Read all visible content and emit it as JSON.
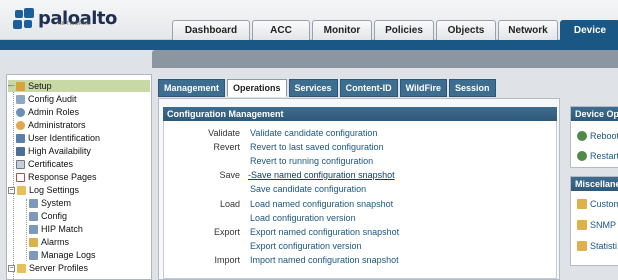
{
  "brand": {
    "name": "paloalto",
    "sub": "NETWORKS"
  },
  "top_tabs": [
    "Dashboard",
    "ACC",
    "Monitor",
    "Policies",
    "Objects",
    "Network",
    "Device"
  ],
  "active_top_tab": "Device",
  "sidebar": [
    "Setup",
    "Config Audit",
    "Admin Roles",
    "Administrators",
    "User Identification",
    "High Availability",
    "Certificates",
    "Response Pages",
    "Log Settings",
    "System",
    "Config",
    "HIP Match",
    "Alarms",
    "Manage Logs",
    "Server Profiles"
  ],
  "sub_tabs": [
    "Management",
    "Operations",
    "Services",
    "Content-ID",
    "WildFire",
    "Session"
  ],
  "active_sub_tab": "Operations",
  "config_section": {
    "title": "Configuration Management",
    "rows": [
      {
        "label": "Validate",
        "link": "Validate candidate configuration"
      },
      {
        "label": "Revert",
        "link": "Revert to last saved configuration"
      },
      {
        "label": "",
        "link": "Revert to running configuration"
      },
      {
        "label": "Save",
        "link": "Save named configuration snapshot"
      },
      {
        "label": "",
        "link": "Save candidate configuration"
      },
      {
        "label": "Load",
        "link": "Load named configuration snapshot"
      },
      {
        "label": "",
        "link": "Load configuration version"
      },
      {
        "label": "Export",
        "link": "Export named configuration snapshot"
      },
      {
        "label": "",
        "link": "Export configuration version"
      },
      {
        "label": "Import",
        "link": "Import named configuration snapshot"
      }
    ]
  },
  "right_panels": {
    "device_ops": {
      "title": "Device Op",
      "items": [
        "Reboot",
        "Restart"
      ]
    },
    "misc": {
      "title": "Miscellane",
      "items": [
        "Custom",
        "SNMP S",
        "Statisti"
      ]
    }
  },
  "colors": {
    "brand_blue": "#1b5784",
    "link_blue": "#1b5784",
    "selected_bg": "#c9d9a6"
  }
}
